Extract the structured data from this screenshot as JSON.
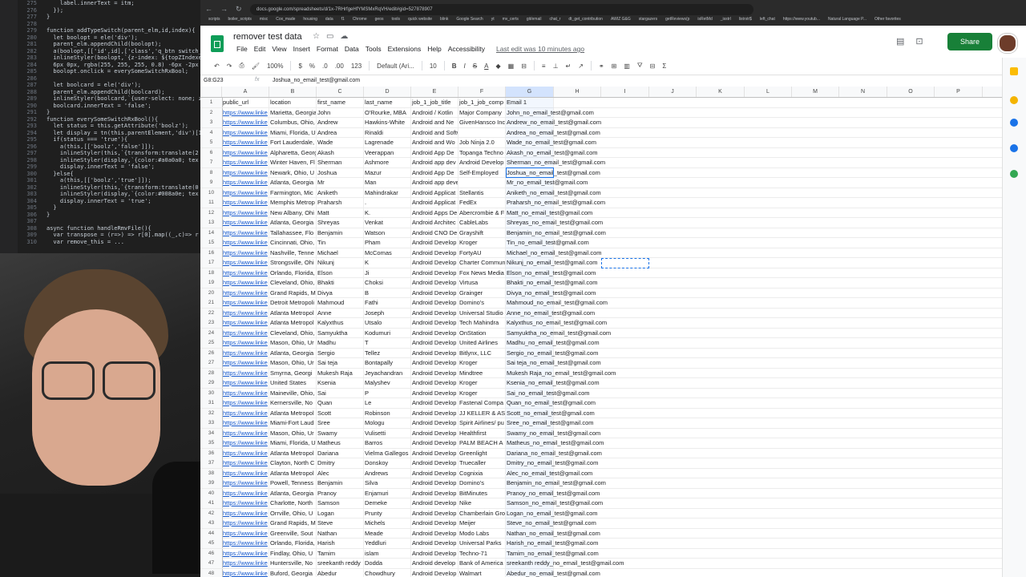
{
  "editor": {
    "line_numbers": [
      "275",
      "276",
      "277",
      "278",
      "279",
      "280",
      "281",
      "282",
      "283",
      "284",
      "285",
      "286",
      "287",
      "288",
      "289",
      "290",
      "291",
      "292",
      "293",
      "294",
      "295",
      "296",
      "297",
      "298",
      "299",
      "300",
      "301",
      "302",
      "303",
      "304",
      "305",
      "306",
      "307",
      "308",
      "309",
      "310",
      "311",
      "312",
      "313",
      "314",
      "315",
      "316",
      "317",
      "318",
      "319",
      "320",
      "321",
      "322",
      "323",
      "324",
      "325",
      "326",
      "327",
      "328",
      "329",
      "330",
      "331",
      "332",
      "333",
      "334",
      "335",
      "336",
      "337",
      "338",
      "339",
      "340",
      "341",
      "342",
      "343",
      "344",
      "345",
      "346",
      "347",
      "348",
      "349",
      "350",
      "351",
      "352",
      "353",
      "354",
      "355",
      "356",
      "357",
      "358",
      "359",
      "360",
      "361",
      "362",
      "363",
      "364",
      "365",
      "366",
      "367",
      "368",
      "369",
      "370",
      "371",
      "372",
      "373",
      "374",
      "375",
      "376",
      "377",
      "378",
      "379",
      "380",
      "381",
      "382",
      "383",
      "384",
      "385",
      "386",
      "387",
      "388",
      "389",
      "390",
      "391",
      "392",
      "393",
      "394"
    ],
    "code_lines": [
      "    label.innerText = itm;",
      "  });",
      "}",
      "",
      "function addTypeSwitch(parent_elm,id,index){",
      "  let boolopt = ele('div');",
      "  parent_elm.appendChild(boolopt);",
      "  a(boolopt,[['id',id],['class','q_btn switch_b",
      "  inlineStyler(boolopt,`{z-index: ${topZIndexer",
      "  6px 0px, rgba(255, 255, 255, 0.8) -6px -2px 6px",
      "  boolopt.onclick = everySomeSwitchRxBool;",
      "",
      "  let boolcard = ele('div');",
      "  parent_elm.appendChild(boolcard);",
      "  inlineStyler(boolcard,`{user-select: none; z-",
      "  boolcard.innerText = 'false';",
      "}",
      "function everySomeSwitchRxBool(){",
      "  let status = this.getAttribute('boolz');",
      "  let display = tn(this.parentElement,'div')[1]",
      "  if(status === 'true'){",
      "    a(this,[['boolz','false']]);",
      "    inlineStyler(this,`{transform:translate(2",
      "    inlineStyler(display,`{color:#a0a0a0; tex",
      "    display.innerText = 'false';",
      "  }else{",
      "    a(this,[['boolz','true']]);",
      "    inlineStyler(this,`{transform:translate(0",
      "    inlineStyler(display,`{color:#008a0e; tex",
      "    display.innerText = 'true';",
      "  }",
      "}",
      "",
      "async function handleRmvFile(){",
      "  var transpose = (r=>) => r[0].map((_,c)=> r",
      "  var remove_this = ..."
    ]
  },
  "browser": {
    "url": "docs.google.com/spreadsheets/d/1x-7RHrfgeHfYMSMxRqVH/edit#gid=527878907",
    "bookmarks": [
      "scripts",
      "boiler_scripts",
      "misc",
      "Cox_made",
      "housing",
      "data",
      "f1",
      "Chrome",
      "geos",
      "tools",
      "quick website",
      "blink",
      "Google Search",
      "yt",
      "mv_certs",
      "git/email",
      "chat_r",
      "dt_get_contribution",
      "AWIZ G&G",
      "stargazers",
      "getReviews(p",
      "isRetMd",
      "_isstrl",
      "listrstr$",
      "left_chat",
      "https://www.youtub...",
      "Natural Language P...",
      "Other favorites"
    ]
  },
  "docs": {
    "title": "remover test data",
    "menus": [
      "File",
      "Edit",
      "View",
      "Insert",
      "Format",
      "Data",
      "Tools",
      "Extensions",
      "Help",
      "Accessibility"
    ],
    "last_edit": "Last edit was 10 minutes ago",
    "share_label": "Share"
  },
  "toolbar": {
    "zoom": "100%",
    "currency": "$",
    "percent": "%",
    "decimals_down": ".0",
    "decimals_up": ".00",
    "format_more": "123",
    "font": "Default (Ari...",
    "font_size": "10",
    "bold": "B",
    "italic": "I",
    "strike": "S",
    "text_color": "A"
  },
  "formula_bar": {
    "name_box": "G8:G23",
    "fx": "fx",
    "value": "Joshua_no_email_test@gmail.com"
  },
  "columns": [
    "A",
    "B",
    "C",
    "D",
    "E",
    "F",
    "G",
    "H",
    "I",
    "J",
    "K",
    "L",
    "M",
    "N",
    "O",
    "P"
  ],
  "rows": [
    [
      "public_url",
      "location",
      "first_name",
      "last_name",
      "job_1_job_title",
      "job_1_job_comp",
      "Email 1"
    ],
    [
      "https://www.linke",
      "Marietta, Georgia",
      "John",
      "O'Rourke, MBA",
      "Android / Kotlin",
      "Major Company",
      "John_no_email_test@gmail.com"
    ],
    [
      "https://www.linke",
      "Columbus, Ohio,",
      "Andrew",
      "Hawkins-White",
      "Android and Ne",
      "GivenHansco Inc",
      "Andrew_no_email_test@gmail.com"
    ],
    [
      "https://www.linke",
      "Miami, Florida, U",
      "Andrea",
      "Rinaldi",
      "Android and Software developer",
      "",
      "Andrea_no_email_test@gmail.com"
    ],
    [
      "https://www.linke",
      "Fort Lauderdale,",
      "Wade",
      "Lagrenade",
      "Android and Wo",
      "Job Ninja 2.0",
      "Wade_no_email_test@gmail.com"
    ],
    [
      "https://www.linke",
      "Alpharetta, Georg",
      "Akash",
      "Veerappan",
      "Android App De",
      "Topanga Techno",
      "Akash_no_email_test@gmail.com"
    ],
    [
      "https://www.linke",
      "Winter Haven, Fl",
      "Sherman",
      "Ashmore",
      "Android app dev",
      "Android Develop",
      "Sherman_no_email_test@gmail.com"
    ],
    [
      "https://www.linke",
      "Newark, Ohio, U",
      "Joshua",
      "Mazur",
      "Android App De",
      "Self-Employed",
      "Joshua_no_email_test@gmail.com"
    ],
    [
      "https://www.linke",
      "Atlanta, Georgia",
      "Mr",
      "Man",
      "Android app developer",
      "",
      "Mr_no_email_test@gmail.com"
    ],
    [
      "https://www.linke",
      "Farmington, Mic",
      "Aniketh",
      "Mahindrakar",
      "Android Applicat",
      "Stellantis",
      "Aniketh_no_email_test@gmail.com"
    ],
    [
      "https://www.linke",
      "Memphis Metrop",
      "Praharsh",
      ".",
      "Android Applicat",
      "FedEx",
      "Praharsh_no_email_test@gmail.com"
    ],
    [
      "https://www.linke",
      "New Albany, Ohi",
      "Matt",
      "K.",
      "Android Apps De",
      "Abercrombie & F",
      "Matt_no_email_test@gmail.com"
    ],
    [
      "https://www.linke",
      "Atlanta, Georgia",
      "Shreyas",
      "Venkat",
      "Android Architec",
      "CableLabs",
      "Shreyas_no_email_test@gmail.com"
    ],
    [
      "https://www.linke",
      "Tallahassee, Flo",
      "Benjamin",
      "Watson",
      "Android CNO De",
      "Grayshift",
      "Benjamin_no_email_test@gmail.com"
    ],
    [
      "https://www.linke",
      "Cincinnati, Ohio,",
      "Tin",
      "Pham",
      "Android Develop",
      "Kroger",
      "Tin_no_email_test@gmail.com"
    ],
    [
      "https://www.linke",
      "Nashville, Tenne",
      "Michael",
      "McComas",
      "Android Develop",
      "FortyAU",
      "Michael_no_email_test@gmail.com"
    ],
    [
      "https://www.linke",
      "Strongsville, Ohi",
      "Nikunj",
      "K",
      "Android Develop",
      "Charter Commun",
      "Nikunj_no_email_test@gmail.com"
    ],
    [
      "https://www.linke",
      "Orlando, Florida,",
      "Elson",
      "Ji",
      "Android Develop",
      "Fox News Media",
      "Elson_no_email_test@gmail.com"
    ],
    [
      "https://www.linke",
      "Cleveland, Ohio,",
      "Bhakti",
      "Choksi",
      "Android Develop",
      "Virtusa",
      "Bhakti_no_email_test@gmail.com"
    ],
    [
      "https://www.linke",
      "Grand Rapids, M",
      "Divya",
      "B",
      "Android Develop",
      "Grainger",
      "Divya_no_email_test@gmail.com"
    ],
    [
      "https://www.linke",
      "Detroit Metropoli",
      "Mahmoud",
      "Fathi",
      "Android Develop",
      "Domino's",
      "Mahmoud_no_email_test@gmail.com"
    ],
    [
      "https://www.linke",
      "Atlanta Metropol",
      "Anne",
      "Joseph",
      "Android Develop",
      "Universal Studio",
      "Anne_no_email_test@gmail.com"
    ],
    [
      "https://www.linke",
      "Atlanta Metropol",
      "Kalyxthus",
      "Utsalo",
      "Android Develop",
      "Tech Mahindra",
      "Kalyxthus_no_email_test@gmail.com"
    ],
    [
      "https://www.linke",
      "Cleveland, Ohio,",
      "Samyuktha",
      "Kodumuri",
      "Android Develop",
      "OnStation",
      "Samyuktha_no_email_test@gmail.com"
    ],
    [
      "https://www.linke",
      "Mason, Ohio, Ur",
      "Madhu",
      "T",
      "Android Develop",
      "United Airlines",
      "Madhu_no_email_test@gmail.com"
    ],
    [
      "https://www.linke",
      "Atlanta, Georgia",
      "Sergio",
      "Tellez",
      "Android Develop",
      "Bitlynx, LLC",
      "Sergio_no_email_test@gmail.com"
    ],
    [
      "https://www.linke",
      "Mason, Ohio, Ur",
      "Sai teja",
      "Bontapally",
      "Android Develop",
      "Kroger",
      "Sai teja_no_email_test@gmail.com"
    ],
    [
      "https://www.linke",
      "Smyrna, Georgi",
      "Mukesh Raja",
      "Jeyachandran",
      "Android Develop",
      "Mindtree",
      "Mukesh Raja_no_email_test@gmail.com"
    ],
    [
      "https://www.linke",
      "United States",
      "Ksenia",
      "Malyshev",
      "Android Develop",
      "Kroger",
      "Ksenia_no_email_test@gmail.com"
    ],
    [
      "https://www.linke",
      "Maineville, Ohio,",
      "Sai",
      "P",
      "Android Develop",
      "Kroger",
      "Sai_no_email_test@gmail.com"
    ],
    [
      "https://www.linke",
      "Kernersville, No",
      "Quan",
      "Le",
      "Android Develop",
      "Fastenal Compa",
      "Quan_no_email_test@gmail.com"
    ],
    [
      "https://www.linke",
      "Atlanta Metropol",
      "Scott",
      "Robinson",
      "Android Develop",
      "JJ KELLER & AS",
      "Scott_no_email_test@gmail.com"
    ],
    [
      "https://www.linke",
      "Miami-Fort Laud",
      "Sree",
      "Mologu",
      "Android Develop",
      "Spirit Airlines/ pu",
      "Sree_no_email_test@gmail.com"
    ],
    [
      "https://www.linke",
      "Mason, Ohio, Ur",
      "Swamy",
      "Vulisetti",
      "Android Develop",
      "Healthfirst",
      "Swamy_no_email_test@gmail.com"
    ],
    [
      "https://www.linke",
      "Miami, Florida, U",
      "Matheus",
      "Barros",
      "Android Develop",
      "PALM BEACH A",
      "Matheus_no_email_test@gmail.com"
    ],
    [
      "https://www.linke",
      "Atlanta Metropol",
      "Dariana",
      "Vielma Gallegos",
      "Android Develop",
      "Greenlight",
      "Dariana_no_email_test@gmail.com"
    ],
    [
      "https://www.linke",
      "Clayton, North C",
      "Dmitry",
      "Donskoy",
      "Android Develop",
      "Truecaller",
      "Dmitry_no_email_test@gmail.com"
    ],
    [
      "https://www.linke",
      "Atlanta Metropol",
      "Alec",
      "Andrews",
      "Android Develop",
      "Cognixia",
      "Alec_no_email_test@gmail.com"
    ],
    [
      "https://www.linke",
      "Powell, Tenness",
      "Benjamin",
      "Silva",
      "Android Develop",
      "Domino's",
      "Benjamin_no_email_test@gmail.com"
    ],
    [
      "https://www.linke",
      "Atlanta, Georgia",
      "Pranoy",
      "Enjamuri",
      "Android Develop",
      "BitMinutes",
      "Pranoy_no_email_test@gmail.com"
    ],
    [
      "https://www.linke",
      "Charlotte, North",
      "Samson",
      "Demeke",
      "Android Develop",
      "Nike",
      "Samson_no_email_test@gmail.com"
    ],
    [
      "https://www.linke",
      "Orrville, Ohio, U",
      "Logan",
      "Prunty",
      "Android Develop",
      "Chamberlain Gro",
      "Logan_no_email_test@gmail.com"
    ],
    [
      "https://www.linke",
      "Grand Rapids, M",
      "Steve",
      "Michels",
      "Android Develop",
      "Meijer",
      "Steve_no_email_test@gmail.com"
    ],
    [
      "https://www.linke",
      "Greenville, Sout",
      "Nathan",
      "Meade",
      "Android Develop",
      "Modo Labs",
      "Nathan_no_email_test@gmail.com"
    ],
    [
      "https://www.linke",
      "Orlando, Florida,",
      "Harish",
      "Yeddluri",
      "Android Develop",
      "Universal Parks",
      "Harish_no_email_test@gmail.com"
    ],
    [
      "https://www.linke",
      "Findlay, Ohio, U",
      "Tamim",
      "islam",
      "Android Develop",
      "Techno-71",
      "Tamim_no_email_test@gmail.com"
    ],
    [
      "https://www.linke",
      "Huntersville, No",
      "sreekanth reddy",
      "Dodda",
      "Android develop",
      "Bank of America",
      "sreekanth reddy_no_email_test@gmail.com"
    ],
    [
      "https://www.linke",
      "Buford, Georgia",
      "Abedur",
      "Chowdhury",
      "Android Develop",
      "Walmart",
      "Abedur_no_email_test@gmail.com"
    ]
  ],
  "colors": {
    "share": "#188038",
    "link": "#1155cc",
    "selection": "#1a73e8"
  }
}
